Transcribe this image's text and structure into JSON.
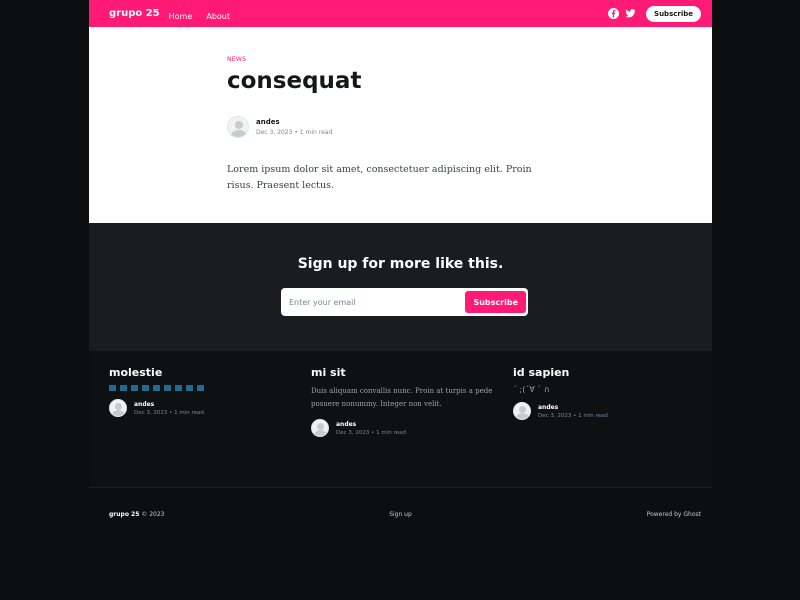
{
  "header": {
    "brand": "grupo 25",
    "nav": [
      "Home",
      "About"
    ],
    "subscribe_label": "Subscribe",
    "accent_color": "#ff1a75"
  },
  "article": {
    "tag": "News",
    "title": "consequat",
    "author": "andes",
    "date": "Dec 3, 2023",
    "read_time": "1 min read",
    "body": "Lorem ipsum dolor sit amet, consectetuer adipiscing elit. Proin risus. Praesent lectus."
  },
  "signup": {
    "heading": "Sign up for more like this.",
    "placeholder": "Enter your email",
    "button": "Subscribe"
  },
  "related": [
    {
      "title": "molestie",
      "author": "andes",
      "date": "Dec 3, 2023",
      "read_time": "1 min read"
    },
    {
      "title": "mi sit",
      "excerpt": "Duis aliquam convallis nunc. Proin at turpis a pede posuere nonummy. Integer non velit.",
      "author": "andes",
      "date": "Dec 3, 2023",
      "read_time": "1 min read"
    },
    {
      "title": "id sapien",
      "excerpt": "´ ;(´∀ ` ∩",
      "author": "andes",
      "date": "Dec 3, 2023",
      "read_time": "1 min read"
    }
  ],
  "footer": {
    "brand": "grupo 25",
    "copyright": "© 2023",
    "signup": "Sign up",
    "powered": "Powered by Ghost"
  },
  "icons": {
    "facebook": "facebook-icon",
    "twitter": "twitter-icon"
  }
}
